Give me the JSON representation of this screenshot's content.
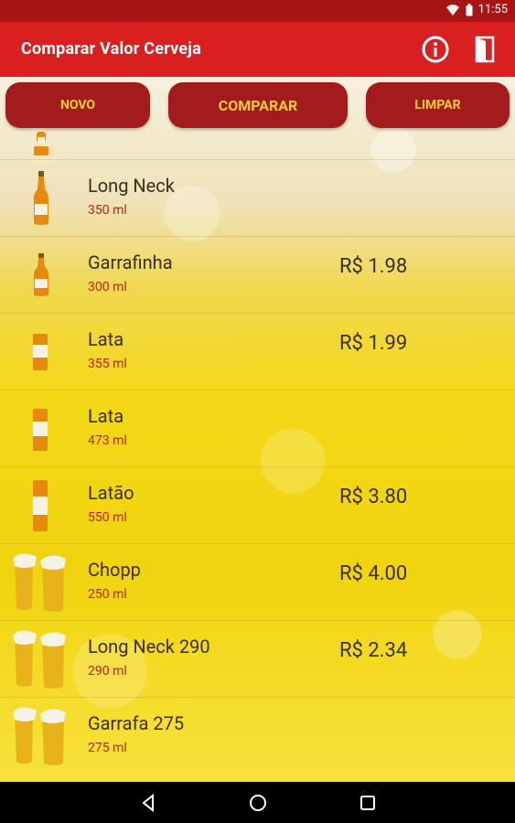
{
  "status": {
    "time": "11:55"
  },
  "app": {
    "title": "Comparar Valor Cerveja"
  },
  "buttons": {
    "novo": "NOVO",
    "comparar": "COMPARAR",
    "limpar": "LIMPAR"
  },
  "items": [
    {
      "name": "Long Neck",
      "volume": "350 ml",
      "price": "",
      "icon": "bottle-long-neck-icon"
    },
    {
      "name": "Garrafinha",
      "volume": "300 ml",
      "price": "R$ 1.98",
      "icon": "bottle-small-icon"
    },
    {
      "name": "Lata",
      "volume": "355 ml",
      "price": "R$ 1.99",
      "icon": "can-icon"
    },
    {
      "name": "Lata",
      "volume": "473 ml",
      "price": "",
      "icon": "can-icon"
    },
    {
      "name": "Latão",
      "volume": "550 ml",
      "price": "R$ 3.80",
      "icon": "can-tall-icon"
    },
    {
      "name": "Chopp",
      "volume": "250 ml",
      "price": "R$ 4.00",
      "icon": "beer-glasses-icon"
    },
    {
      "name": "Long Neck 290",
      "volume": "290 ml",
      "price": "R$ 2.34",
      "icon": "beer-glasses-icon"
    },
    {
      "name": "Garrafa 275",
      "volume": "275 ml",
      "price": "",
      "icon": "beer-glasses-icon"
    }
  ],
  "colors": {
    "status_bar": "#a71515",
    "app_bar": "#d91f1f",
    "button_bg": "#a31b1b",
    "button_text": "#f5cf36",
    "volume_text": "#b3261e"
  }
}
